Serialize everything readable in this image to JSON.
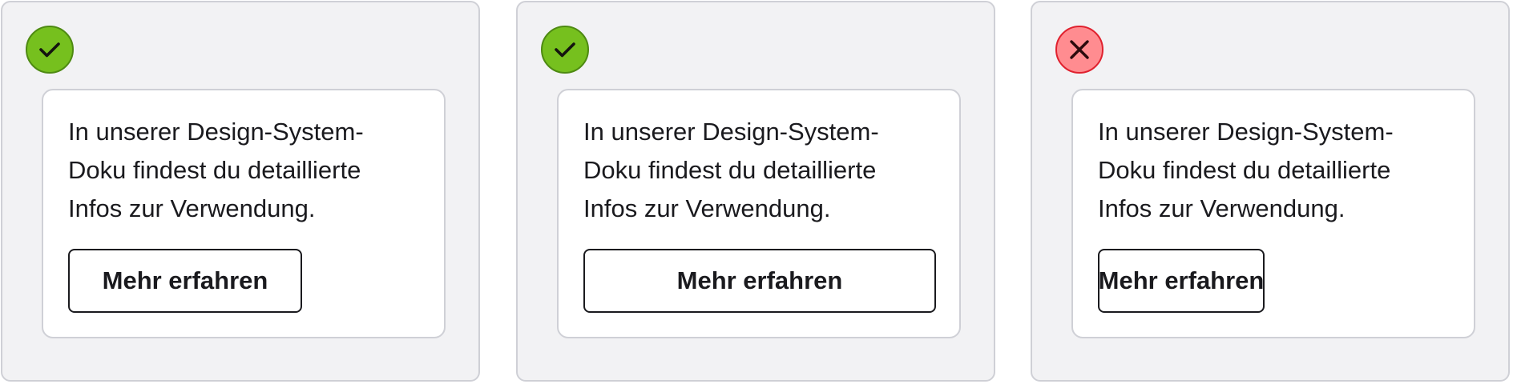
{
  "examples": [
    {
      "status": "correct",
      "status_icon": "check-icon",
      "text": "In unserer Design-System-Doku findest du detaillierte Infos zur Verwendung.",
      "button_label": "Mehr erfahren"
    },
    {
      "status": "correct",
      "status_icon": "check-icon",
      "text": "In unserer Design-System-Doku findest du detaillierte Infos zur Verwendung.",
      "button_label": "Mehr erfahren"
    },
    {
      "status": "incorrect",
      "status_icon": "close-icon",
      "text": "In unserer Design-System-Doku findest du detaillierte Infos zur Verwendung.",
      "button_label": "Mehr erfahren"
    }
  ],
  "colors": {
    "panel_background": "#f2f2f4",
    "border": "#cfd0d6",
    "correct": "#76c01e",
    "incorrect": "#ff8c90",
    "text": "#1a1a1e"
  }
}
